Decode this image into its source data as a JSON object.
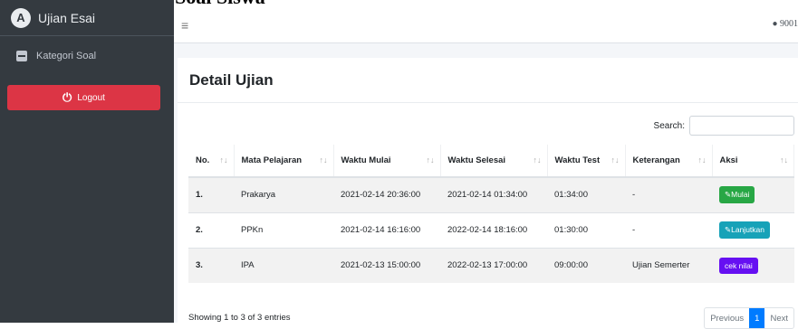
{
  "doc_heading": "…ampilan Kategori Soal Siswa",
  "sidebar": {
    "brand": "Ujian Esai",
    "items": [
      {
        "label": "Kategori Soal",
        "icon": "document-icon"
      }
    ],
    "logout_label": "Logout"
  },
  "topbar": {
    "menu_icon": "≡",
    "user_label": "9001"
  },
  "card": {
    "title": "Detail Ujian"
  },
  "search": {
    "label": "Search:",
    "value": ""
  },
  "table": {
    "headers": [
      "No.",
      "Mata Pelajaran",
      "Waktu Mulai",
      "Waktu Selesai",
      "Waktu Test",
      "Keterangan",
      "Aksi"
    ],
    "rows": [
      {
        "no": "1.",
        "mapel": "Prakarya",
        "mulai": "2021-02-14 20:36:00",
        "selesai": "2021-02-14 01:34:00",
        "test": "01:34:00",
        "ket": "-",
        "aksi": "Mulai",
        "aksi_color": "#28a745"
      },
      {
        "no": "2.",
        "mapel": "PPKn",
        "mulai": "2021-02-14 16:16:00",
        "selesai": "2022-02-14 18:16:00",
        "test": "01:30:00",
        "ket": "-",
        "aksi": "Lanjutkan",
        "aksi_color": "#17a2b8"
      },
      {
        "no": "3.",
        "mapel": "IPA",
        "mulai": "2021-02-13 15:00:00",
        "selesai": "2022-02-13 17:00:00",
        "test": "09:00:00",
        "ket": "Ujian Semerter",
        "aksi": "cek nilai",
        "aksi_color": "#6610f2"
      }
    ]
  },
  "footer": {
    "info": "Showing 1 to 3 of 3 entries",
    "prev": "Previous",
    "page": "1",
    "next": "Next"
  }
}
